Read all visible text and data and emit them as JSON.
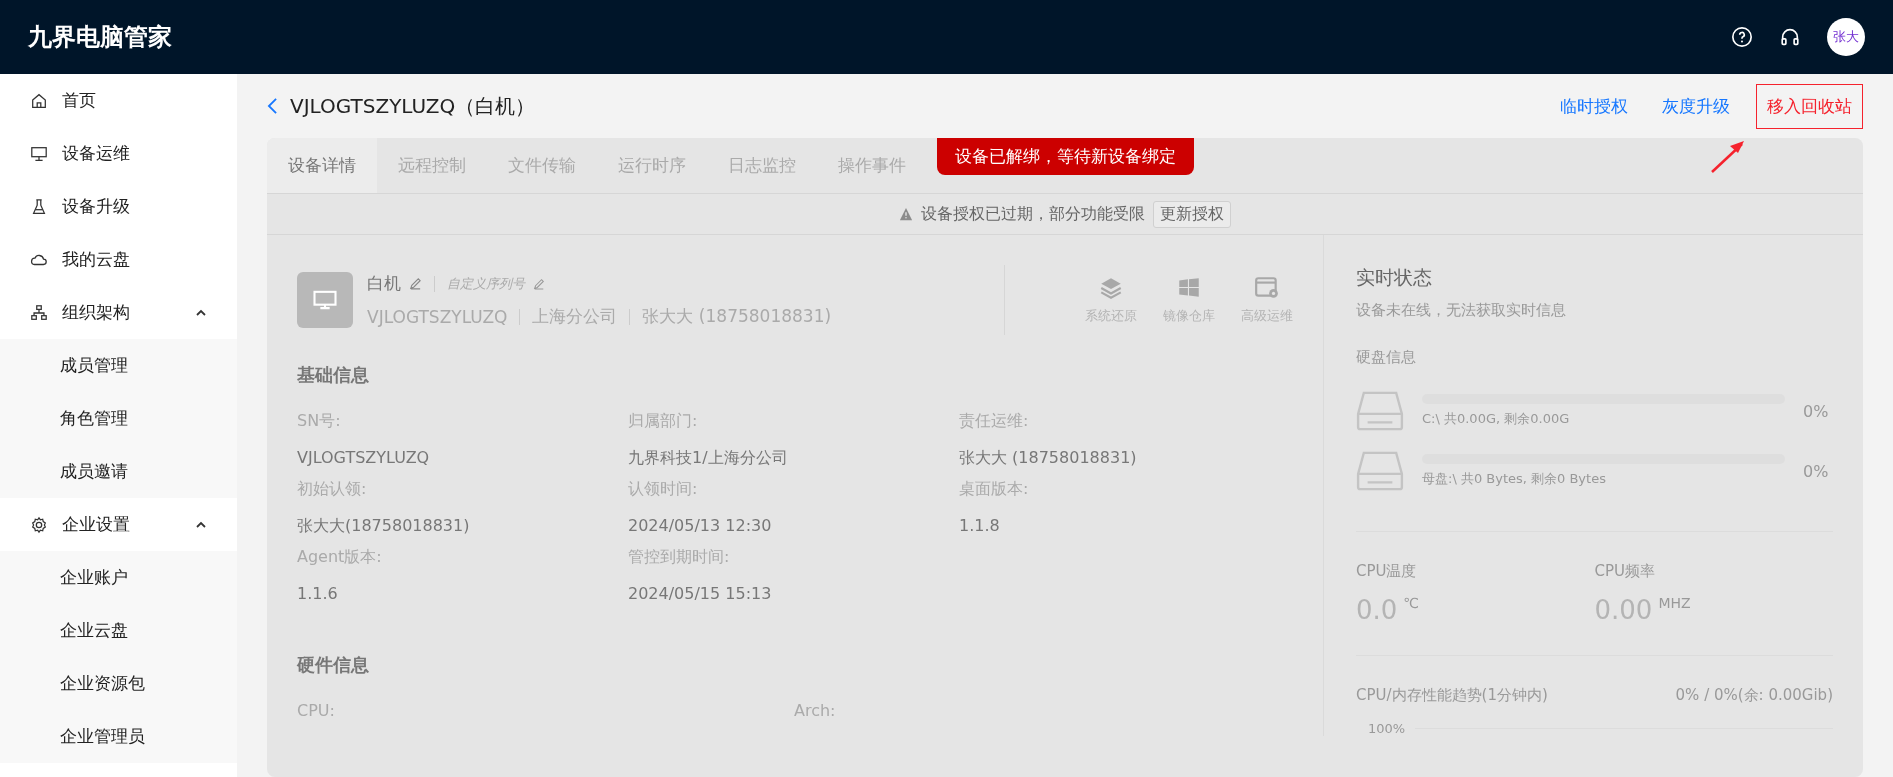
{
  "header": {
    "title": "九界电脑管家",
    "avatar": "张大"
  },
  "sidebar": [
    {
      "label": "首页",
      "kind": "item"
    },
    {
      "label": "设备运维",
      "kind": "item"
    },
    {
      "label": "设备升级",
      "kind": "item"
    },
    {
      "label": "我的云盘",
      "kind": "item"
    },
    {
      "label": "组织架构",
      "kind": "group",
      "expanded": true,
      "children": [
        {
          "label": "成员管理"
        },
        {
          "label": "角色管理"
        },
        {
          "label": "成员邀请"
        }
      ]
    },
    {
      "label": "企业设置",
      "kind": "group",
      "expanded": true,
      "children": [
        {
          "label": "企业账户"
        },
        {
          "label": "企业云盘"
        },
        {
          "label": "企业资源包"
        },
        {
          "label": "企业管理员"
        }
      ]
    }
  ],
  "page": {
    "title": "VJLOGTSZYLUZQ（白机）",
    "actions": [
      {
        "label": "临时授权",
        "highlighted": false
      },
      {
        "label": "灰度升级",
        "highlighted": false
      },
      {
        "label": "移入回收站",
        "highlighted": true
      }
    ]
  },
  "tabs": [
    {
      "label": "设备详情",
      "selected": true
    },
    {
      "label": "远程控制",
      "selected": false
    },
    {
      "label": "文件传输",
      "selected": false
    },
    {
      "label": "运行时序",
      "selected": false
    },
    {
      "label": "日志监控",
      "selected": false
    },
    {
      "label": "操作事件",
      "selected": false
    }
  ],
  "toast": "设备已解绑，等待新设备绑定",
  "warning": {
    "text": "设备授权已过期，部分功能受限",
    "button": "更新授权"
  },
  "device": {
    "name": "白机",
    "serial_hint": "自定义序列号",
    "meta": [
      "VJLOGTSZYLUZQ",
      "上海分公司",
      "张大大 (18758018831)"
    ],
    "tools": [
      {
        "label": "系统还原"
      },
      {
        "label": "镜像仓库"
      },
      {
        "label": "高级运维"
      }
    ]
  },
  "basic": {
    "title": "基础信息",
    "fields": [
      {
        "label": "SN号:",
        "value": "VJLOGTSZYLUZQ"
      },
      {
        "label": "归属部门:",
        "value": "九界科技1/上海分公司"
      },
      {
        "label": "责任运维:",
        "value": "张大大 (18758018831)"
      },
      {
        "label": "初始认领:",
        "value": "张大大(18758018831)"
      },
      {
        "label": "认领时间:",
        "value": "2024/05/13 12:30"
      },
      {
        "label": "桌面版本:",
        "value": "1.1.8"
      },
      {
        "label": "Agent版本:",
        "value": "1.1.6"
      },
      {
        "label": "管控到期时间:",
        "value": "2024/05/15 15:13"
      }
    ]
  },
  "hardware": {
    "title": "硬件信息",
    "fields": [
      {
        "label": "CPU:"
      },
      {
        "label": "Arch:"
      }
    ]
  },
  "realtime": {
    "title": "实时状态",
    "subtitle": "设备未在线，无法获取实时信息",
    "disk_title": "硬盘信息",
    "disks": [
      {
        "caption": "C:\\ 共0.00G, 剩余0.00G",
        "percent": "0%",
        "level": 0
      },
      {
        "caption": "母盘:\\ 共0 Bytes, 剩余0 Bytes",
        "percent": "0%",
        "level": 0
      }
    ],
    "metrics": [
      {
        "label": "CPU温度",
        "value": "0.0",
        "unit": "℃"
      },
      {
        "label": "CPU频率",
        "value": "0.00",
        "unit": "MHZ"
      }
    ],
    "trend": {
      "title": "CPU/内存性能趋势(1分钟内)",
      "summary": "0% / 0%(余: 0.00Gib)",
      "tick": "100%"
    }
  }
}
